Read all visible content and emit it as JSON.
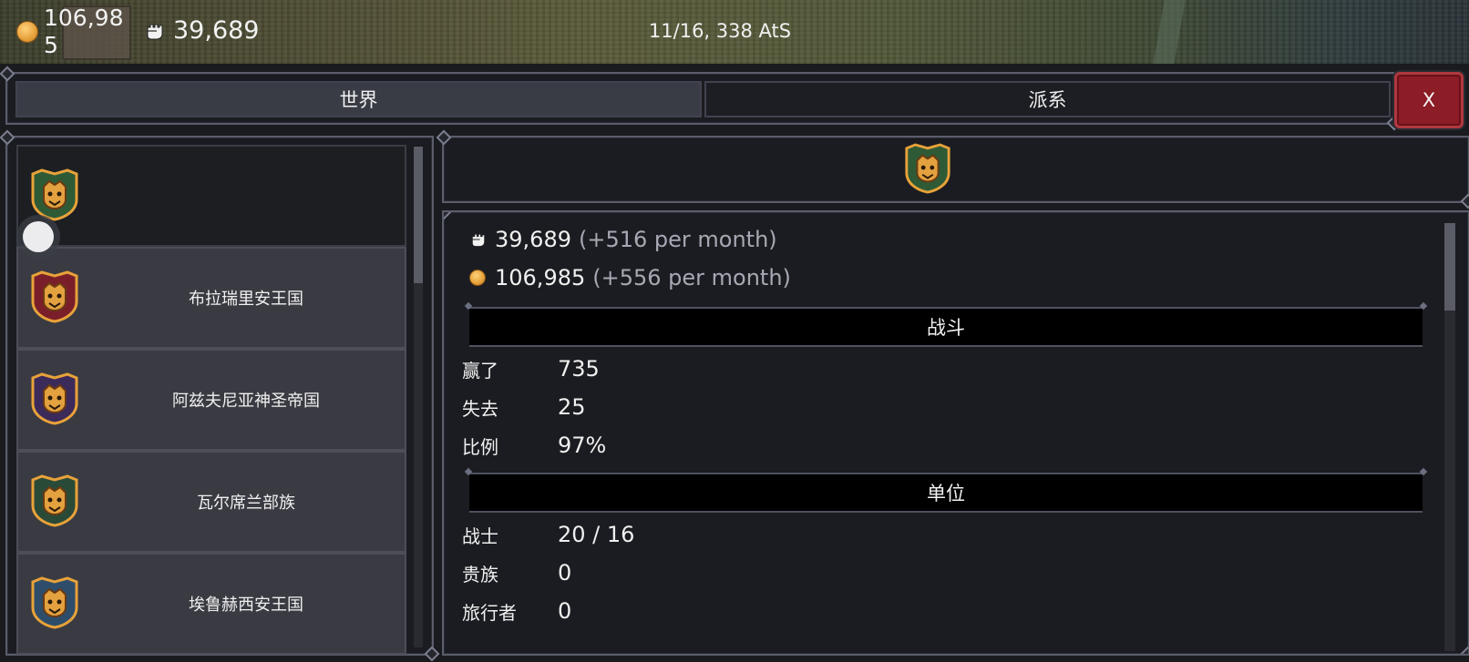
{
  "topbar": {
    "gold": "106,985",
    "power": "39,689",
    "date": "11/16, 338 AtS",
    "icons": [
      "gold-coin-icon",
      "fist-icon"
    ]
  },
  "tabs": [
    {
      "label": "世界",
      "active": true
    },
    {
      "label": "派系",
      "active": false
    }
  ],
  "close_label": "X",
  "factions": [
    {
      "name": "",
      "selected": true,
      "crest": "green-boar-crest-icon"
    },
    {
      "name": "布拉瑞里安王国",
      "selected": false,
      "crest": "red-boar-crest-icon"
    },
    {
      "name": "阿兹夫尼亚神圣帝国",
      "selected": false,
      "crest": "purple-hand-crest-icon"
    },
    {
      "name": "瓦尔席兰部族",
      "selected": false,
      "crest": "green-eagle-crest-icon"
    },
    {
      "name": "埃鲁赫西安王国",
      "selected": false,
      "crest": "blue-boar-crest-icon"
    }
  ],
  "detail": {
    "power": "39,689",
    "power_change": "(+516 per month)",
    "gold": "106,985",
    "gold_change": "(+556 per month)",
    "battle_section": "战斗",
    "battle_rows": [
      {
        "label": "赢了",
        "value": "735"
      },
      {
        "label": "失去",
        "value": "25"
      },
      {
        "label": "比例",
        "value": "97%"
      }
    ],
    "units_section": "单位",
    "unit_rows": [
      {
        "label": "战士",
        "value": "20 / 16"
      },
      {
        "label": "贵族",
        "value": "0"
      },
      {
        "label": "旅行者",
        "value": "0"
      }
    ]
  },
  "colors": {
    "close_button": "#8c1c26",
    "active_tab": "#3a3c45",
    "gold": "#e6a03a"
  }
}
